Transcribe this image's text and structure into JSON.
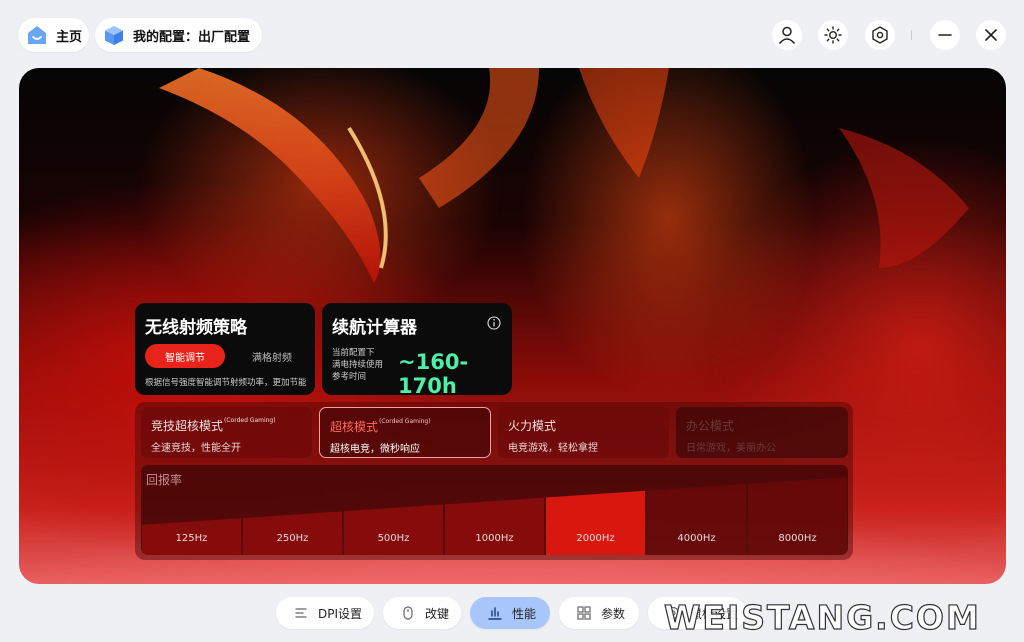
{
  "header": {
    "home_label": "主页",
    "config_label": "我的配置：出厂配置",
    "icons": [
      "user-icon",
      "brightness-icon",
      "settings-icon",
      "minimize-icon",
      "close-icon"
    ]
  },
  "radio_card": {
    "title": "无线射频策略",
    "option_on": "智能调节",
    "option_off": "满格射频",
    "description": "根据信号强度智能调节射频功率，更加节能"
  },
  "battery_card": {
    "title": "续航计算器",
    "description_lines": [
      "当前配置下",
      "满电持续使用",
      "参考时间"
    ],
    "value": "~160-170h"
  },
  "modes": [
    {
      "title": "竞技超核模式",
      "tag": "(Corded Gaming)",
      "desc": "全速竞技，性能全开"
    },
    {
      "title": "超核模式",
      "tag": "(Corded Gaming)",
      "desc": "超核电竞，微秒响应"
    },
    {
      "title": "火力模式",
      "tag": "",
      "desc": "电竞游戏，轻松拿捏"
    },
    {
      "title": "办公模式",
      "tag": "",
      "desc": "日常游戏，美丽办公"
    }
  ],
  "polling": {
    "title": "回报率",
    "rates": [
      "125Hz",
      "250Hz",
      "500Hz",
      "1000Hz",
      "2000Hz",
      "4000Hz",
      "8000Hz"
    ],
    "selected_index": 4
  },
  "bottom_nav": {
    "dpi": "DPI设置",
    "keys": "改键",
    "performance": "性能",
    "params": "参数",
    "mouse": "鼠标设置"
  },
  "watermark": "WEISTANG.COM",
  "colors": {
    "accent": "#e8231c",
    "battery_value": "#4ef0a8",
    "active_tab": "#a9c6fb"
  }
}
